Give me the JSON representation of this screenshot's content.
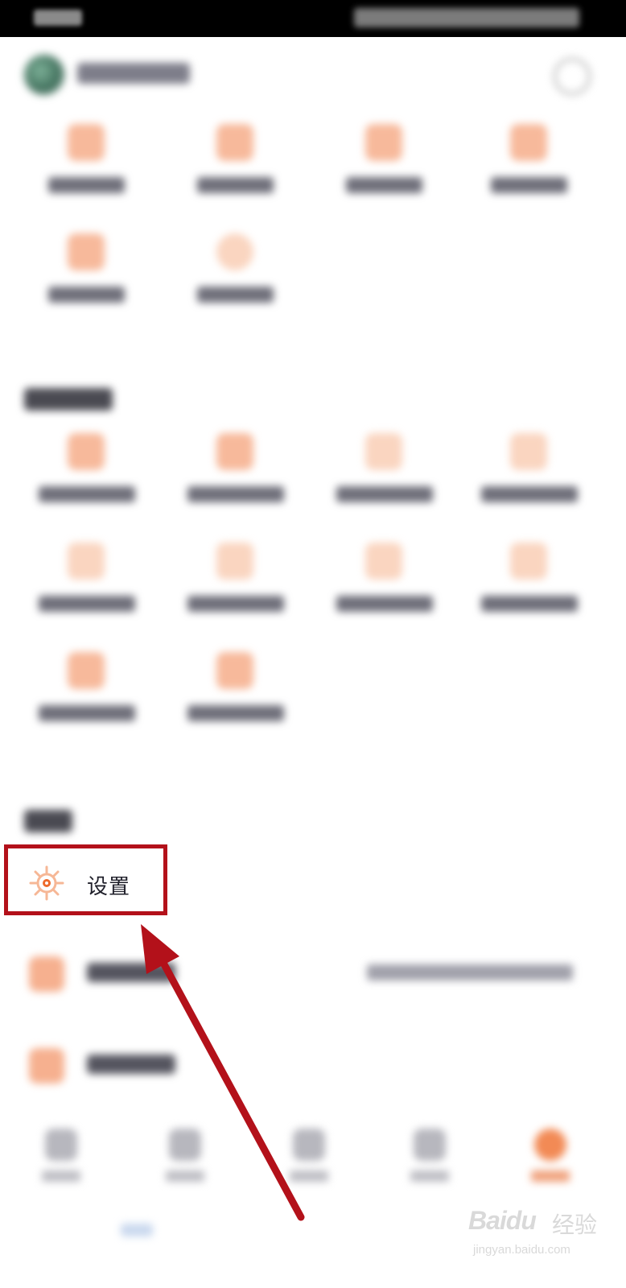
{
  "settings": {
    "label": "设置"
  },
  "watermark": {
    "brand": "Baidu",
    "suffix": "经验",
    "url": "jingyan.baidu.com"
  },
  "colors": {
    "accent": "#f28a55",
    "highlight_box": "#b3111a",
    "arrow": "#b3111a",
    "text_dark": "#1f1f2a"
  },
  "icons": {
    "settings": "gear-icon",
    "search": "search-icon"
  }
}
